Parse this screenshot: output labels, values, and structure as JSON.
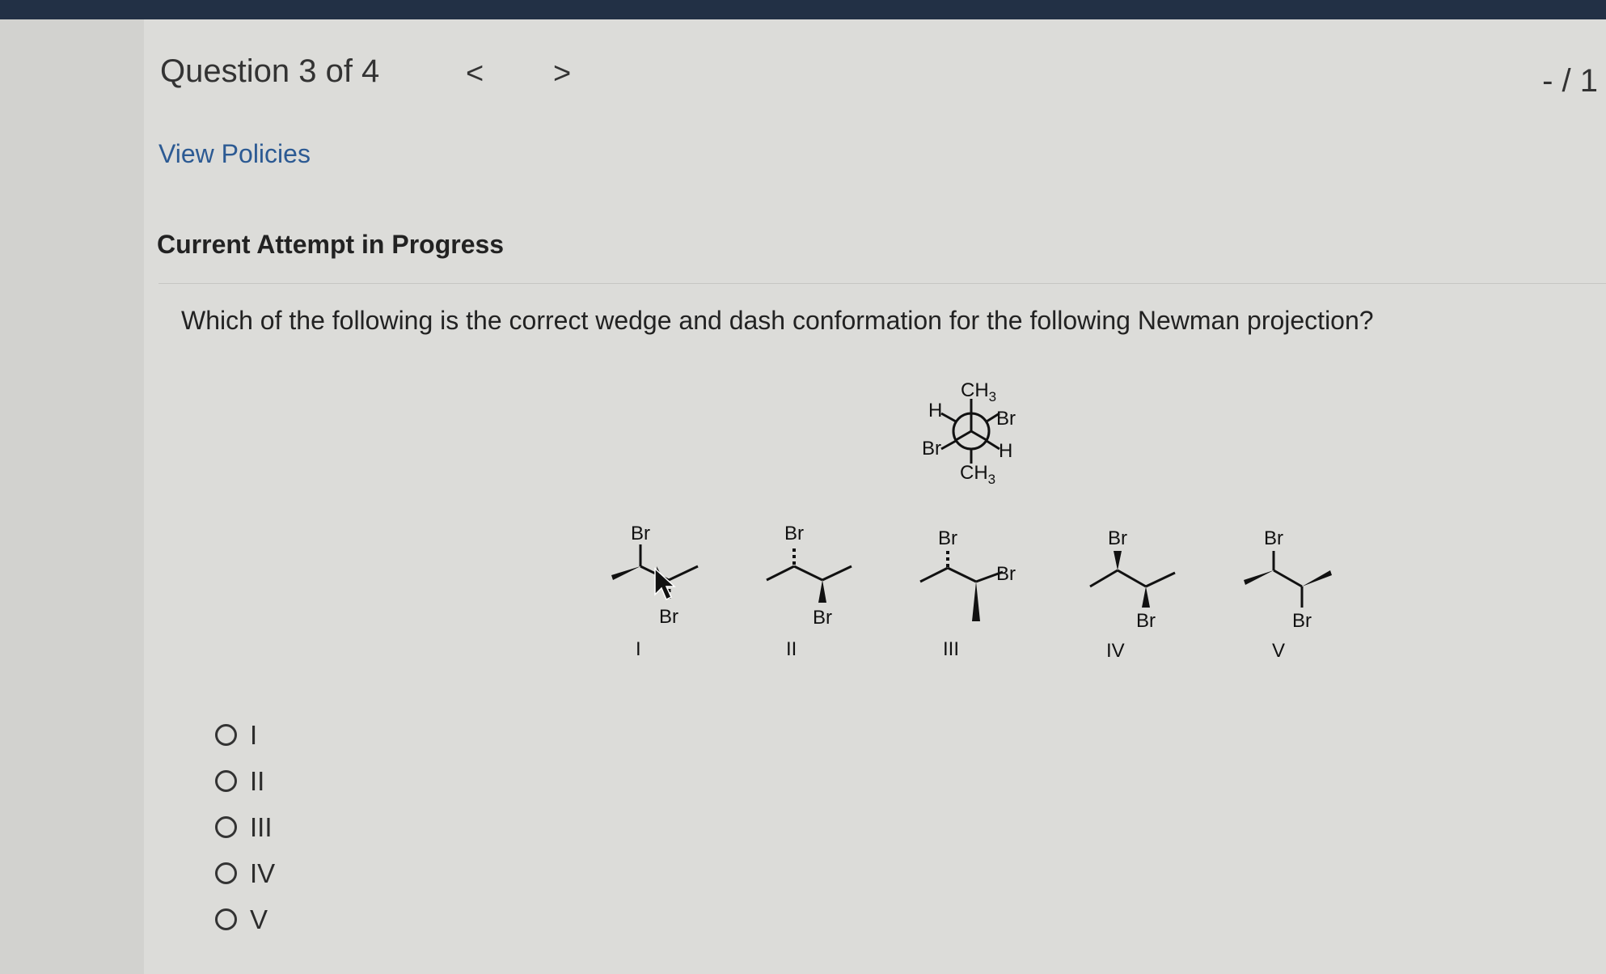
{
  "header": {
    "question_label": "Question 3 of 4",
    "prev_glyph": "<",
    "next_glyph": ">",
    "score": "- / 1"
  },
  "links": {
    "view_policies": "View Policies"
  },
  "attempt_status": "Current Attempt in Progress",
  "question_text": "Which of the following is the correct wedge and dash conformation for the following Newman projection?",
  "newman": {
    "labels": [
      "CH3",
      "H",
      "Br",
      "Br",
      "H",
      "CH3"
    ]
  },
  "structures": [
    {
      "numeral": "I",
      "labels": [
        "Br",
        "Br"
      ]
    },
    {
      "numeral": "II",
      "labels": [
        "Br",
        "Br"
      ]
    },
    {
      "numeral": "III",
      "labels": [
        "Br",
        "Br"
      ]
    },
    {
      "numeral": "IV",
      "labels": [
        "Br",
        "Br"
      ]
    },
    {
      "numeral": "V",
      "labels": [
        "Br",
        "Br"
      ]
    }
  ],
  "options": [
    {
      "label": "I"
    },
    {
      "label": "II"
    },
    {
      "label": "III"
    },
    {
      "label": "IV"
    },
    {
      "label": "V"
    }
  ]
}
